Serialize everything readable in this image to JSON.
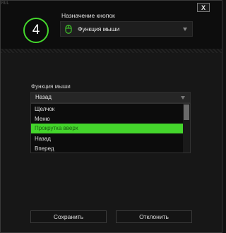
{
  "window": {
    "corner_text": "RUL",
    "close_label": "X"
  },
  "header": {
    "key_number": "4",
    "title": "Назначение кнопок",
    "select_value": "Функция мыши",
    "select_icon": "mouse-icon",
    "accent_color": "#44d62c"
  },
  "mouse_function": {
    "label": "Функция мыши",
    "selected_value": "Назад",
    "options": [
      "Щелчок",
      "Меню",
      "Прокрутка вверх",
      "Назад",
      "Вперед"
    ],
    "highlighted_index": 2
  },
  "footer": {
    "save_label": "Сохранить",
    "cancel_label": "Отклонить"
  }
}
